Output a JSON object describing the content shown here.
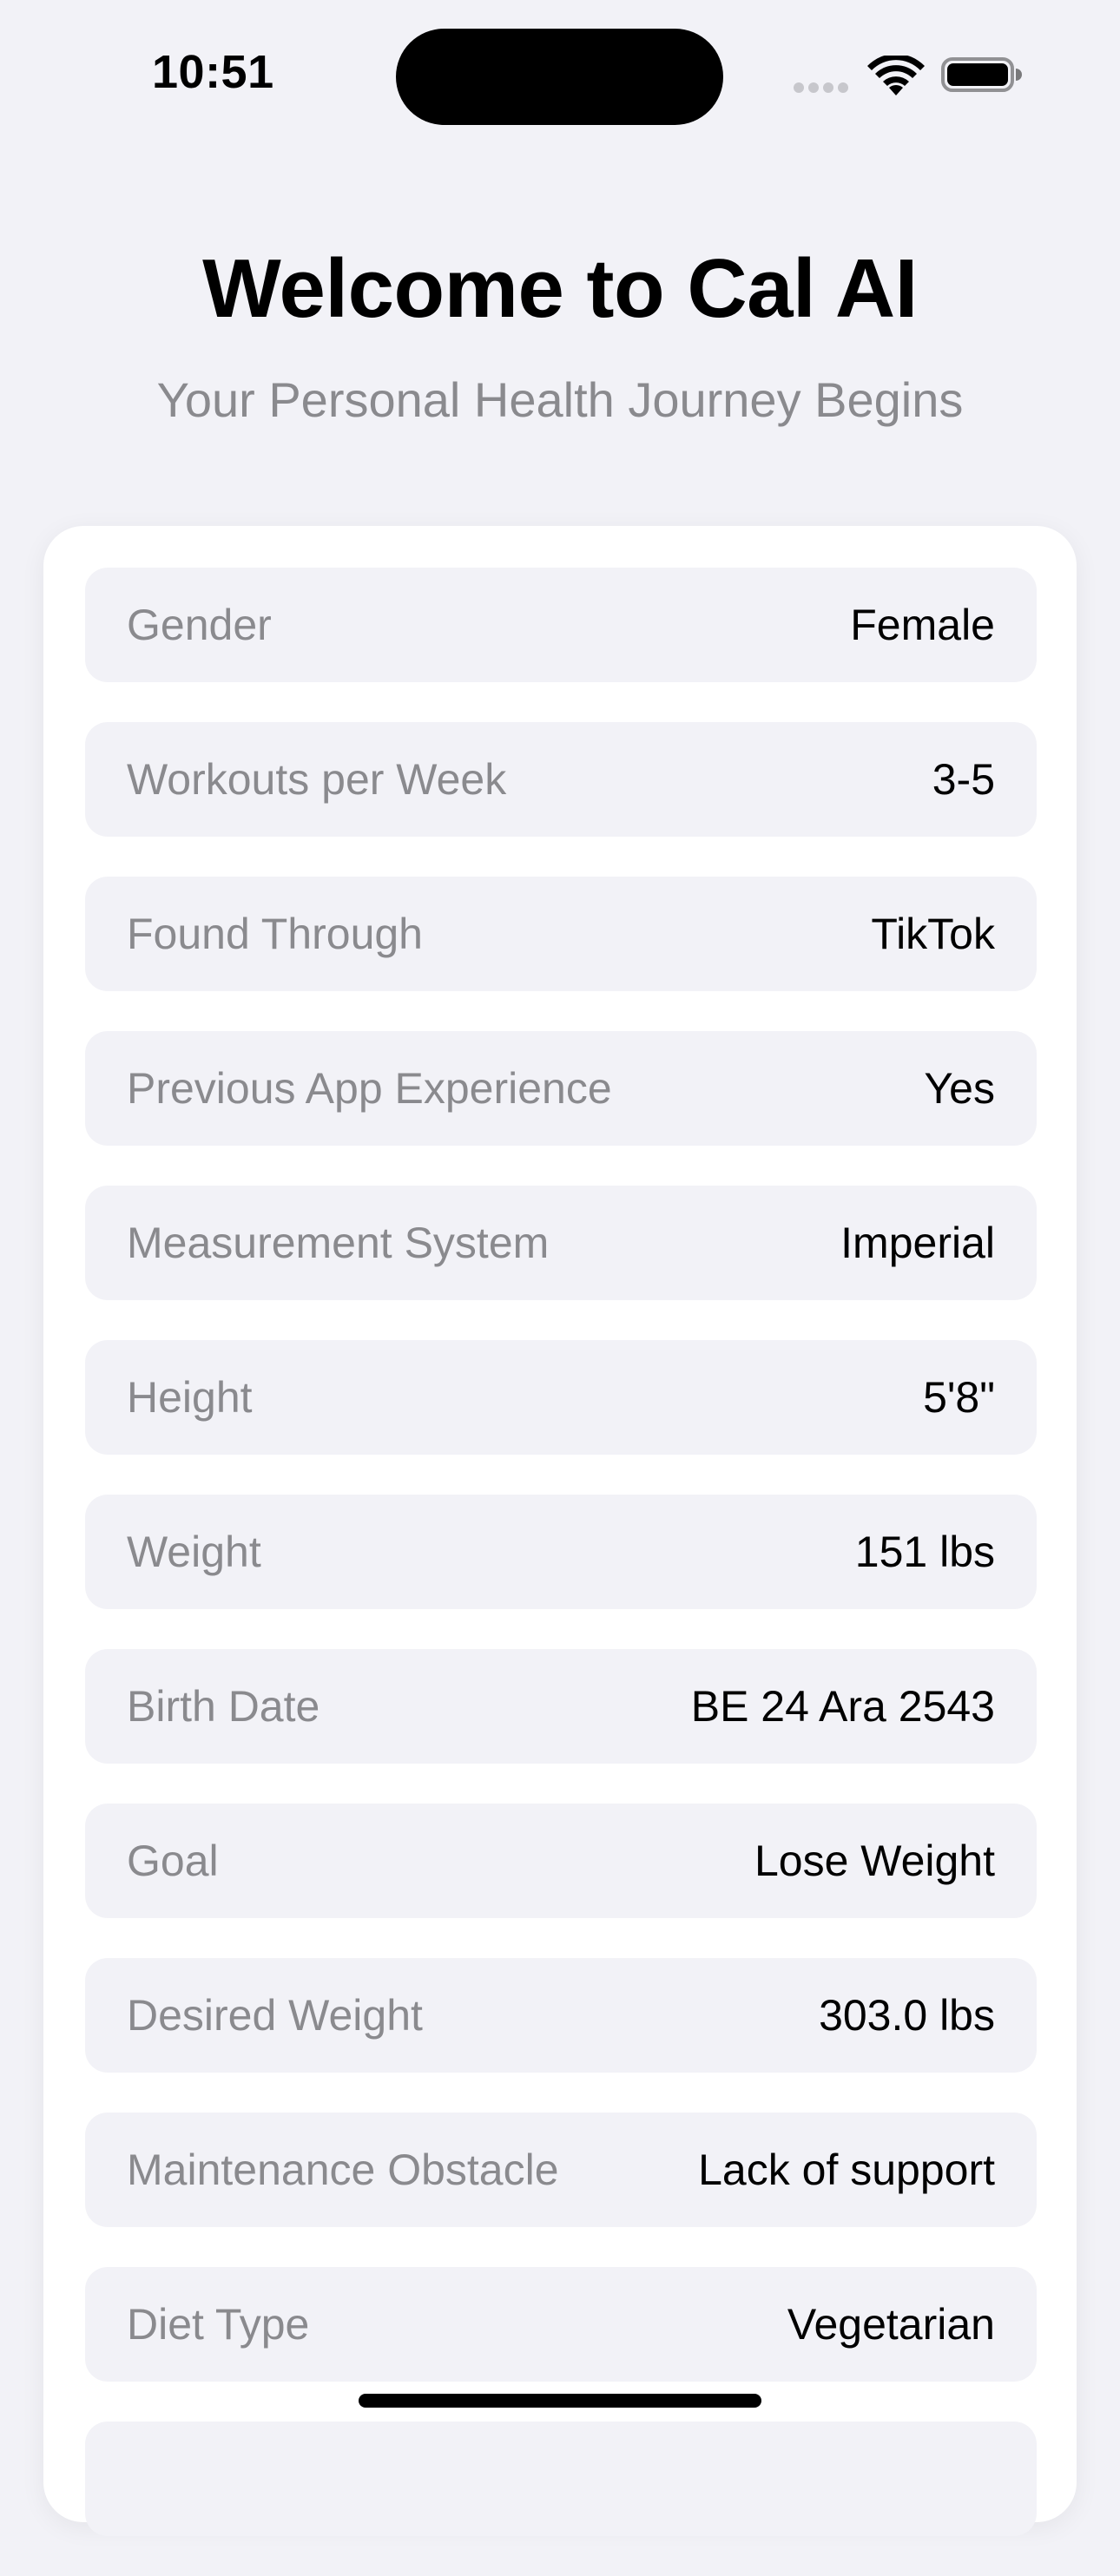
{
  "status_bar": {
    "time": "10:51"
  },
  "header": {
    "title": "Welcome to Cal AI",
    "subtitle": "Your Personal Health Journey Begins"
  },
  "profile": {
    "rows": [
      {
        "label": "Gender",
        "value": "Female"
      },
      {
        "label": "Workouts per Week",
        "value": "3-5"
      },
      {
        "label": "Found Through",
        "value": "TikTok"
      },
      {
        "label": "Previous App Experience",
        "value": "Yes"
      },
      {
        "label": "Measurement System",
        "value": "Imperial"
      },
      {
        "label": "Height",
        "value": "5'8\""
      },
      {
        "label": "Weight",
        "value": "151 lbs"
      },
      {
        "label": "Birth Date",
        "value": "BE 24 Ara 2543"
      },
      {
        "label": "Goal",
        "value": "Lose Weight"
      },
      {
        "label": "Desired Weight",
        "value": "303.0 lbs"
      },
      {
        "label": "Maintenance Obstacle",
        "value": "Lack of support"
      },
      {
        "label": "Diet Type",
        "value": "Vegetarian"
      }
    ]
  },
  "icons": {
    "signal": "cellular-signal-icon",
    "wifi": "wifi-icon",
    "battery": "battery-icon"
  }
}
